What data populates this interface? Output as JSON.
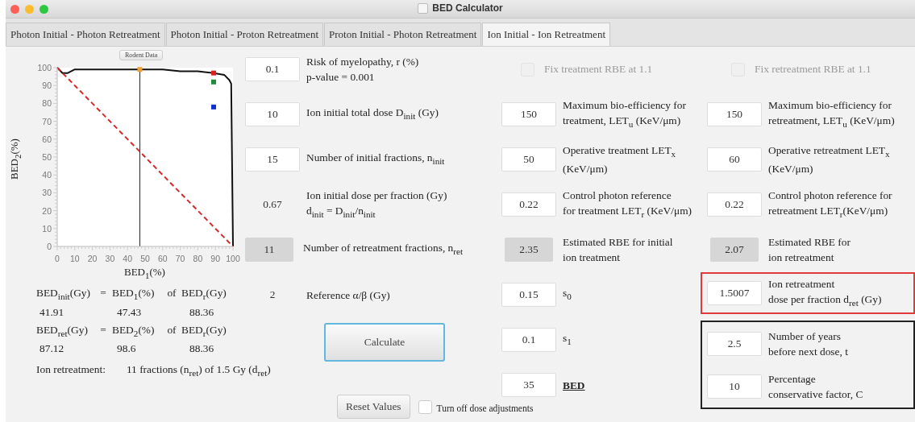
{
  "window": {
    "title": "BED Calculator"
  },
  "tabs": [
    {
      "label": "Photon Initial - Photon Retreatment",
      "selected": false
    },
    {
      "label": "Photon Initial - Proton Retreatment",
      "selected": false
    },
    {
      "label": "Proton Initial - Photon Retreatment",
      "selected": false
    },
    {
      "label": "Ion Initial - Ion Retreatment",
      "selected": true
    }
  ],
  "chart": {
    "rodent_button": "Rodent Data",
    "chart_data": {
      "type": "line",
      "xlabel": "BED$_{1}$(%)",
      "ylabel": "BED$_{2}$(%)",
      "xlim": [
        0,
        100
      ],
      "ylim": [
        0,
        100
      ],
      "xticks": [
        0,
        10,
        20,
        30,
        40,
        50,
        60,
        70,
        80,
        90,
        100
      ],
      "yticks": [
        0,
        10,
        20,
        30,
        40,
        50,
        60,
        70,
        80,
        90,
        100
      ],
      "x": [
        0,
        3,
        6,
        10,
        20,
        30,
        40,
        47,
        50,
        60,
        70,
        80,
        89,
        95,
        98,
        99,
        100
      ],
      "series": [
        {
          "color": "#111111",
          "values": [
            100,
            97,
            97,
            99,
            99,
            99,
            99,
            99,
            99,
            99,
            98,
            98,
            97,
            96,
            93,
            91,
            0
          ]
        },
        {
          "color": "#d42a2a",
          "line_style": "dashed",
          "values": [
            100,
            97,
            94,
            90,
            80,
            70,
            60,
            53,
            50,
            40,
            30,
            20,
            11,
            5,
            2,
            1,
            0
          ]
        },
        {
          "color": "#f0a030",
          "marker": "square",
          "values": [
            null,
            null,
            null,
            null,
            null,
            null,
            null,
            99,
            null,
            null,
            null,
            null,
            null,
            null,
            null,
            null,
            null
          ]
        },
        {
          "color": "#dd1f1f",
          "marker": "square",
          "values": [
            null,
            null,
            null,
            null,
            null,
            null,
            null,
            null,
            null,
            null,
            null,
            null,
            97,
            null,
            null,
            null,
            null
          ]
        },
        {
          "color": "#1f8a3a",
          "marker": "square",
          "values": [
            null,
            null,
            null,
            null,
            null,
            null,
            null,
            null,
            null,
            null,
            null,
            null,
            92,
            null,
            null,
            null,
            null
          ]
        },
        {
          "color": "#1030d0",
          "marker": "square",
          "values": [
            null,
            null,
            null,
            null,
            null,
            null,
            null,
            null,
            null,
            null,
            null,
            null,
            78,
            null,
            null,
            null,
            null
          ]
        }
      ],
      "ref_lines": [
        {
          "axis": "x",
          "value": 47,
          "color": "#222222"
        }
      ]
    }
  },
  "summary": {
    "rows": [
      {
        "kind": "heading",
        "cells": [
          "BED$_{init}$(Gy)",
          "=",
          "BED$_{1}$(%)",
          "of",
          "BED$_{r}$(Gy)"
        ]
      },
      {
        "kind": "values",
        "cells": [
          "41.91",
          "47.43",
          "88.36"
        ]
      },
      {
        "kind": "heading",
        "cells": [
          "BED$_{ret}$(Gy)",
          "=",
          "BED$_{2}$(%)",
          "of",
          "BED$_{r}$(Gy)"
        ]
      },
      {
        "kind": "values",
        "cells": [
          "87.12",
          "98.6",
          "88.36"
        ]
      }
    ],
    "result_label": "Ion retreatment:",
    "result_text": "11 fractions (n$_{ret}$) of 1.5 Gy (d$_{ret}$)"
  },
  "columns": [
    {
      "items": [
        {
          "kind": "input",
          "value": "0.1",
          "label": [
            "Risk of myelopathy, r (%)",
            "p-value = 0.001"
          ]
        },
        {
          "kind": "input",
          "value": "10",
          "label": [
            "Ion initial total dose D$_{init}$ (Gy)"
          ]
        },
        {
          "kind": "input",
          "value": "15",
          "label": [
            "Number of initial fractions, n$_{init}$"
          ]
        },
        {
          "kind": "plain",
          "value": "0.67",
          "label": [
            "Ion initial dose per fraction (Gy)",
            "d$_{init}$ = D$_{init}$/n$_{init}$"
          ]
        },
        {
          "kind": "readonly",
          "value": "11",
          "label": [
            "Number of retreatment fractions, n$_{ret}$"
          ]
        },
        {
          "kind": "plain",
          "value": "2",
          "label": [
            "Reference α/β (Gy)"
          ]
        },
        {
          "kind": "button",
          "label": "Calculate",
          "focused": true
        },
        {
          "kind": "empty"
        },
        {
          "kind": "reset",
          "label": "Reset Values",
          "checkbox": {
            "label": "Turn off dose adjustments",
            "checked": false,
            "disabled": false
          }
        }
      ]
    },
    {
      "items": [
        {
          "kind": "checkbox",
          "label": "Fix treatment RBE at 1.1",
          "checked": false,
          "disabled": true
        },
        {
          "kind": "input",
          "value": "150",
          "label": [
            "Maximum bio-efficiency for",
            "treatment, LET$_{u}$ (KeV/μm)"
          ]
        },
        {
          "kind": "input",
          "value": "50",
          "label": [
            "Operative treatment LET$_{x}$",
            "(KeV/μm)"
          ]
        },
        {
          "kind": "input",
          "value": "0.22",
          "label": [
            "Control photon reference",
            "for treatment LET$_{r}$ (KeV/μm)"
          ]
        },
        {
          "kind": "readonly",
          "value": "2.35",
          "label": [
            "Estimated RBE for initial",
            "ion treatment"
          ]
        },
        {
          "kind": "input",
          "value": "0.15",
          "label": [
            "s$_{0}$"
          ]
        },
        {
          "kind": "input",
          "value": "0.1",
          "label": [
            "s$_{1}$"
          ]
        },
        {
          "kind": "input",
          "value": "35",
          "label": [
            "BED"
          ],
          "underlined": true
        }
      ]
    },
    {
      "items": [
        {
          "kind": "checkbox",
          "label": "Fix retreatment RBE at 1.1",
          "checked": false,
          "disabled": true
        },
        {
          "kind": "input",
          "value": "150",
          "label": [
            "Maximum bio-efficiency for",
            "retreatment, LET$_{u}$ (KeV/μm)"
          ]
        },
        {
          "kind": "input",
          "value": "60",
          "label": [
            "Operative retreatment LET$_{x}$",
            "(KeV/μm)"
          ]
        },
        {
          "kind": "input",
          "value": "0.22",
          "label": [
            "Control photon reference for",
            "retreatment LET$_{r}$(KeV/μm)"
          ]
        },
        {
          "kind": "readonly",
          "value": "2.07",
          "label": [
            "Estimated RBE for",
            "ion retreatment"
          ]
        },
        {
          "kind": "input",
          "value": "1.5007",
          "label": [
            "Ion retreatment",
            "dose per fraction d$_{ret}$ (Gy)"
          ],
          "color": "#e03a3a"
        },
        {
          "kind": "input",
          "value": "2.5",
          "label": [
            "Number of years",
            "before next dose, t"
          ],
          "color": "#222222"
        },
        {
          "kind": "input",
          "value": "10",
          "label": [
            "Percentage",
            "conservative factor, C"
          ],
          "color": "#222222"
        }
      ]
    }
  ]
}
